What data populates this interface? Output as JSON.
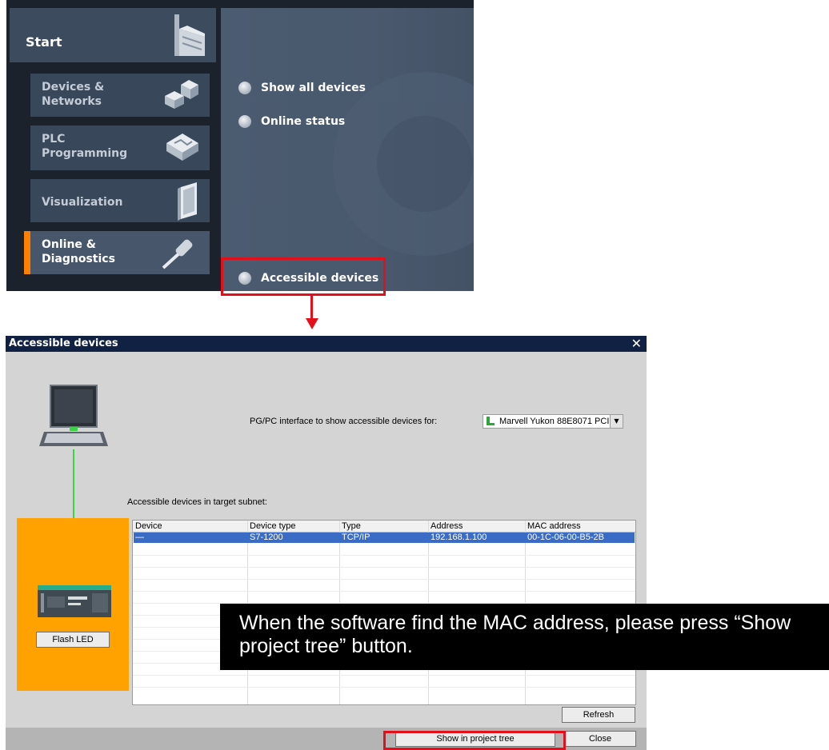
{
  "portal": {
    "nav": {
      "start": "Start",
      "devices_networks": "Devices &\nNetworks",
      "plc_programming": "PLC\nProgramming",
      "visualization": "Visualization",
      "online_diagnostics": "Online &\nDiagnostics"
    },
    "links": {
      "show_all_devices": "Show all devices",
      "online_status": "Online status",
      "accessible_devices": "Accessible devices"
    },
    "colors": {
      "active_marker": "#ff7f00",
      "highlight": "#e3101b"
    }
  },
  "dialog": {
    "title": "Accessible devices",
    "close_symbol": "✕",
    "pgpc_label": "PG/PC interface to show accessible devices for:",
    "pgpc_value": "Marvell Yukon 88E8071 PCI",
    "subnet_label": "Accessible devices in target subnet:",
    "flash_led": "Flash LED",
    "table": {
      "columns": [
        "Device",
        "Device type",
        "Type",
        "Address",
        "MAC address"
      ],
      "rows": [
        [
          "—",
          "S7-1200",
          "TCP/IP",
          "192.168.1.100",
          "00-1C-06-00-B5-2B"
        ]
      ]
    },
    "refresh": "Refresh",
    "show_in_project_tree": "Show in project tree",
    "close": "Close"
  },
  "callout": {
    "text": "When the software find the MAC address, please press “Show project tree” button."
  }
}
